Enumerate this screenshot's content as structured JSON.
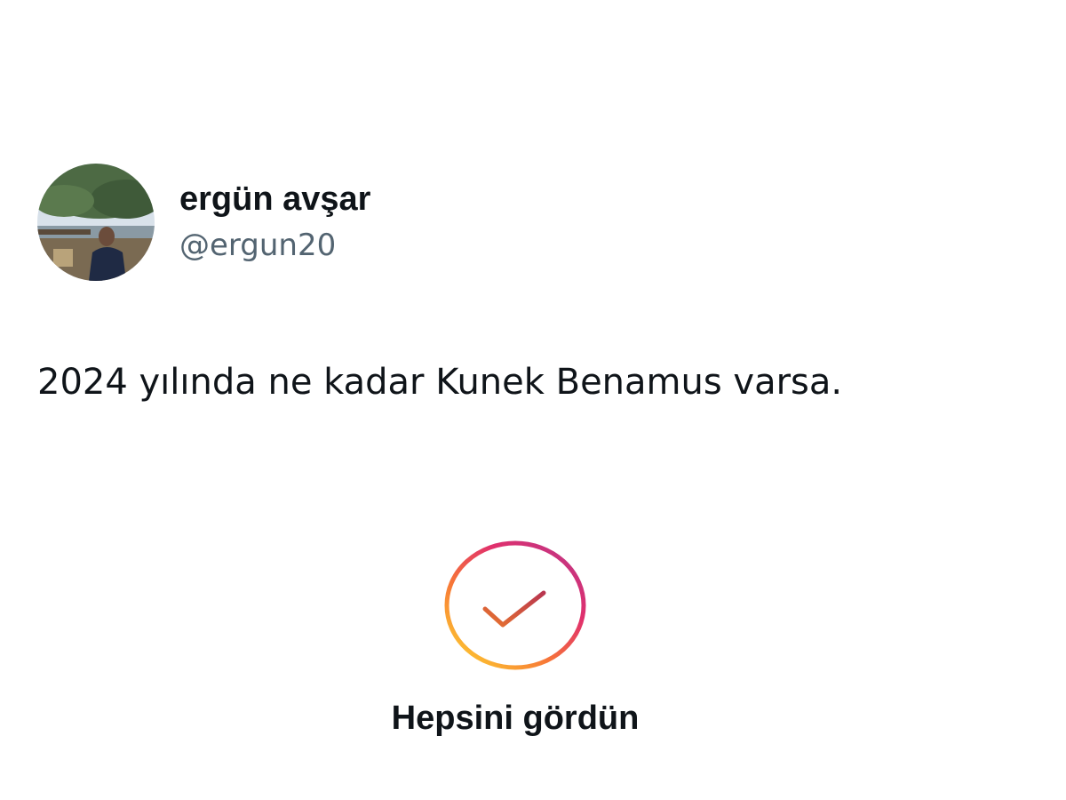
{
  "post": {
    "author": {
      "display_name": "ergün avşar",
      "handle": "@ergun20"
    },
    "text": "2024 yılında ne kadar Kunek Benamus varsa."
  },
  "feed_end": {
    "icon": "check-circle-icon",
    "label": "Hepsini gördün",
    "gradient_colors": [
      "#fdc830",
      "#f77737",
      "#e1306c",
      "#c13584"
    ]
  }
}
